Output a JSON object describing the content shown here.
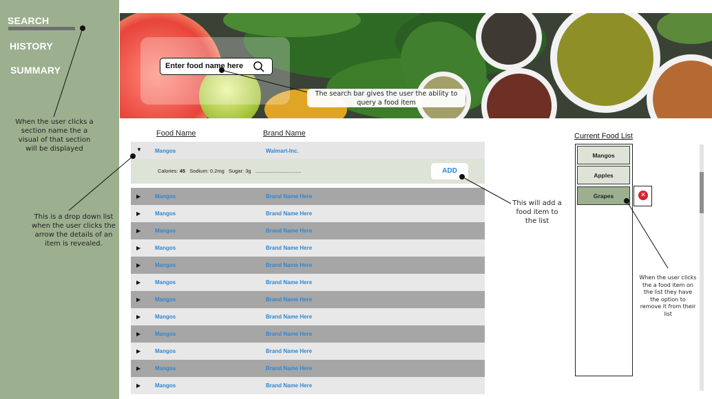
{
  "sidebar": {
    "items": [
      {
        "label": "SEARCH",
        "active": true
      },
      {
        "label": "HISTORY",
        "active": false
      },
      {
        "label": "SUMMARY",
        "active": false
      }
    ],
    "bg_color": "#9caf8f"
  },
  "search": {
    "placeholder": "Enter food name here",
    "icon": "search-icon"
  },
  "table": {
    "columns": [
      "Food Name",
      "Brand Name"
    ],
    "expanded": {
      "food": "Mangos",
      "brand": "Walmart-Inc.",
      "calories_label": "Calories:",
      "calories_value": "45",
      "sodium": "Sodium: 0.2mg",
      "sugar": "Sugar: 3g",
      "dots": "................................",
      "add_label": "ADD"
    },
    "rows": [
      {
        "food": "Mangos",
        "brand": "Brand Name Here"
      },
      {
        "food": "Mangos",
        "brand": "Brand Name Here"
      },
      {
        "food": "Mangos",
        "brand": "Brand Name Here"
      },
      {
        "food": "Mangos",
        "brand": "Brand Name Here"
      },
      {
        "food": "Mangos",
        "brand": "Brand Name Here"
      },
      {
        "food": "Mangos",
        "brand": "Brand Name Here"
      },
      {
        "food": "Mangos",
        "brand": "Brand Name Here"
      },
      {
        "food": "Mangos",
        "brand": "Brand Name Here"
      },
      {
        "food": "Mangos",
        "brand": "Brand Name Here"
      },
      {
        "food": "Mangos",
        "brand": "Brand Name Here"
      },
      {
        "food": "Mangos",
        "brand": "Brand Name Here"
      },
      {
        "food": "Mangos",
        "brand": "Brand Name Here"
      }
    ]
  },
  "food_list": {
    "title": "Current Food List",
    "items": [
      {
        "label": "Mangos",
        "selected": false
      },
      {
        "label": "Apples",
        "selected": false
      },
      {
        "label": "Grapes",
        "selected": true
      }
    ],
    "remove_icon": "close-icon"
  },
  "annotations": {
    "section": "When the user clicks a section name the a visual of that section will be displayed",
    "dropdown": "This is a drop down list when the user clicks the arrow the details of an item is revealed.",
    "searchbar": "The search bar gives the user the ability to query a food item",
    "add": "This will add a food item to the list",
    "remove": "When the user clicks the a food item on the list they have the option to remove it from their list"
  },
  "colors": {
    "accent_link": "#2f86d0",
    "sidebar": "#9caf8f",
    "remove": "#d9232e"
  }
}
